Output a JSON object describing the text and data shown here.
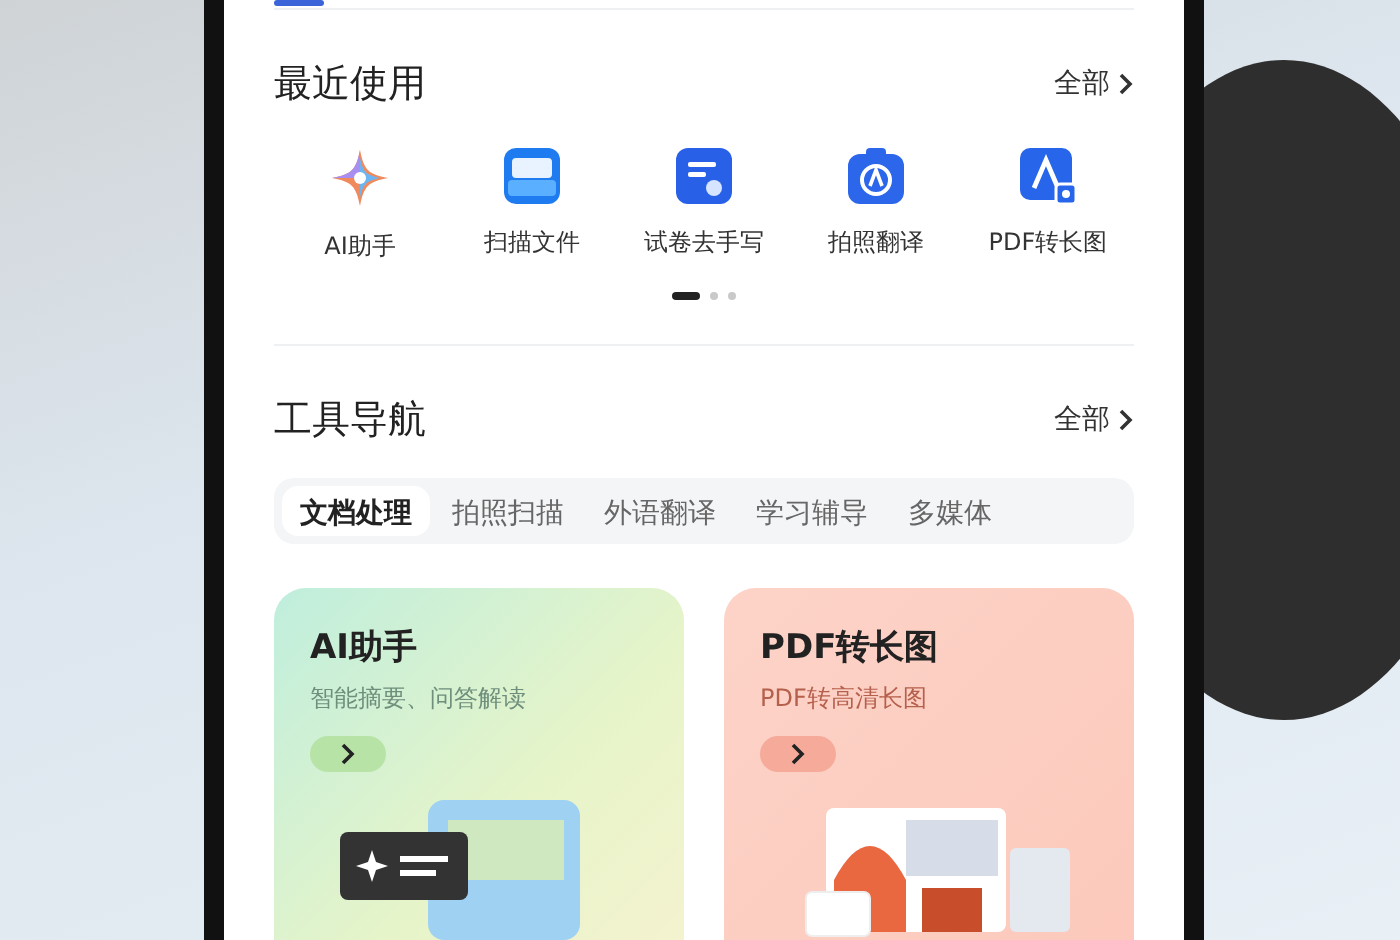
{
  "recent": {
    "title": "最近使用",
    "more": "全部",
    "items": [
      {
        "label": "AI助手",
        "kind": "ai"
      },
      {
        "label": "扫描文件",
        "kind": "scan"
      },
      {
        "label": "试卷去手写",
        "kind": "exam"
      },
      {
        "label": "拍照翻译",
        "kind": "camera"
      },
      {
        "label": "PDF转长图",
        "kind": "pdf"
      }
    ],
    "pages": [
      {
        "selected": true
      },
      {
        "selected": false
      },
      {
        "selected": false
      }
    ]
  },
  "tools": {
    "title": "工具导航",
    "more": "全部",
    "tabs": [
      {
        "label": "文档处理",
        "selected": true
      },
      {
        "label": "拍照扫描",
        "selected": false
      },
      {
        "label": "外语翻译",
        "selected": false
      },
      {
        "label": "学习辅导",
        "selected": false
      },
      {
        "label": "多媒体",
        "selected": false
      }
    ],
    "cards": [
      {
        "title": "AI助手",
        "subtitle": "智能摘要、问答解读",
        "kind": "ai"
      },
      {
        "title": "PDF转长图",
        "subtitle": "PDF转高清长图",
        "kind": "pdf"
      }
    ]
  }
}
